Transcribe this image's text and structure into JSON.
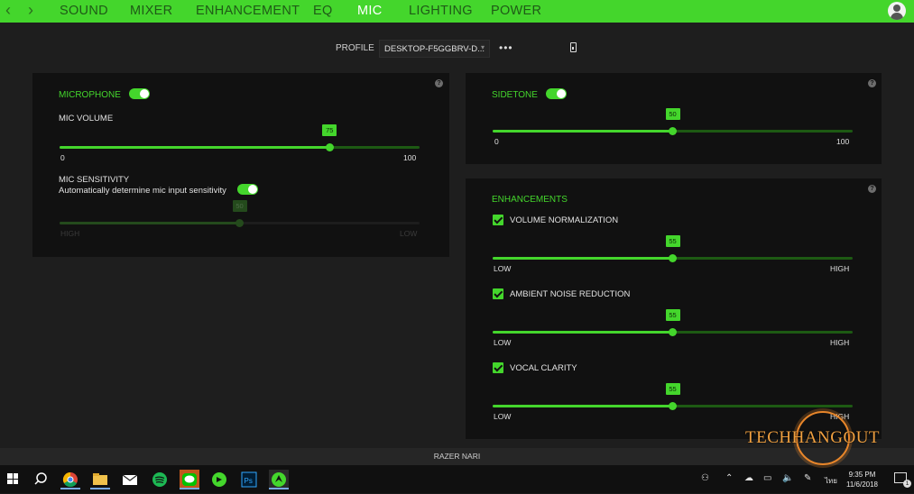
{
  "nav": {
    "back_glyph": "‹",
    "forward_glyph": "›",
    "tabs": [
      "SOUND",
      "MIXER",
      "ENHANCEMENT",
      "EQ",
      "MIC",
      "LIGHTING",
      "POWER"
    ],
    "active_tab": "MIC",
    "accent_color": "#44d62c"
  },
  "profile": {
    "label": "PROFILE",
    "value": "DESKTOP-F5GGBRV-D...",
    "more_label": "•••"
  },
  "microphone": {
    "title": "MICROPHONE",
    "enabled": true,
    "volume": {
      "label": "MIC VOLUME",
      "value": "75",
      "min": "0",
      "max": "100"
    },
    "sensitivity": {
      "label": "MIC SENSITIVITY",
      "auto_label": "Automatically determine mic input sensitivity",
      "auto_enabled": true,
      "value": "50",
      "min": "HIGH",
      "max": "LOW"
    }
  },
  "sidetone": {
    "title": "SIDETONE",
    "enabled": true,
    "value": "50",
    "min": "0",
    "max": "100"
  },
  "enhancements": {
    "title": "ENHANCEMENTS",
    "items": [
      {
        "label": "VOLUME NORMALIZATION",
        "checked": true,
        "value": "55",
        "min": "LOW",
        "max": "HIGH"
      },
      {
        "label": "AMBIENT NOISE REDUCTION",
        "checked": true,
        "value": "55",
        "min": "LOW",
        "max": "HIGH"
      },
      {
        "label": "VOCAL CLARITY",
        "checked": true,
        "value": "55",
        "min": "LOW",
        "max": "HIGH"
      }
    ]
  },
  "help_glyph": "?",
  "footer": {
    "device_name": "RAZER NARI"
  },
  "taskbar": {
    "time": "9:35 PM",
    "date": "11/6/2018",
    "language": "ไทย",
    "notification_count": "1",
    "apps": [
      "windows-start",
      "search",
      "chrome",
      "file-explorer",
      "mail",
      "spotify",
      "line",
      "razer-synapse-alt",
      "photoshop",
      "razer-synapse"
    ]
  },
  "watermark": {
    "text": "TECHHANGOUT"
  }
}
